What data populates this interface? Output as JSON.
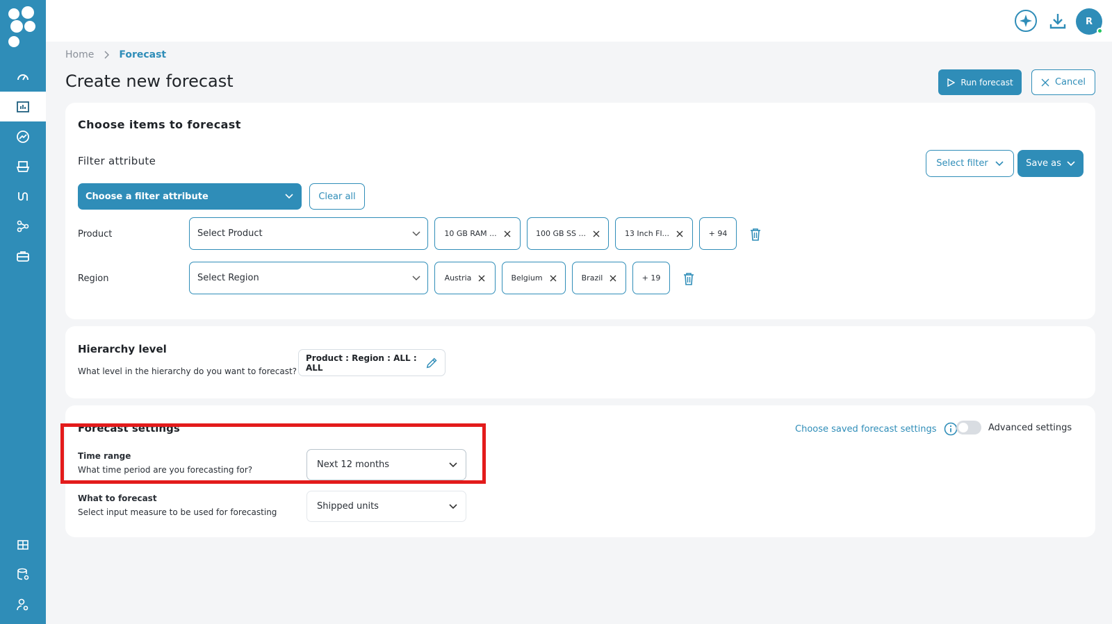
{
  "topbar": {
    "avatar_initial": "R"
  },
  "breadcrumb": {
    "home": "Home",
    "current": "Forecast"
  },
  "page": {
    "title": "Create new forecast",
    "run_label": "Run forecast",
    "cancel_label": "Cancel"
  },
  "items": {
    "title": "Choose items to forecast",
    "filter_attribute_label": "Filter attribute",
    "select_filter": "Select filter",
    "save_as": "Save as",
    "choose_attr": "Choose a filter attribute",
    "clear_all": "Clear all",
    "product": {
      "label": "Product",
      "placeholder": "Select Product",
      "chips": [
        "10 GB RAM ...",
        "100 GB SS ...",
        "13 Inch Fl..."
      ],
      "more": "+ 94"
    },
    "region": {
      "label": "Region",
      "placeholder": "Select Region",
      "chips": [
        "Austria",
        "Belgium",
        "Brazil"
      ],
      "more": "+ 19"
    }
  },
  "hierarchy": {
    "title": "Hierarchy level",
    "question": "What level in the hierarchy do you want to forecast?",
    "value": "Product : Region : ALL : ALL"
  },
  "settings": {
    "title": "Forecast settings",
    "saved_link": "Choose saved forecast settings",
    "advanced_label": "Advanced settings",
    "advanced_on": false,
    "time_range": {
      "label": "Time range",
      "desc": "What time period are you forecasting for?",
      "value": "Next 12 months"
    },
    "what": {
      "label": "What to forecast",
      "desc": "Select input measure to be used for forecasting",
      "value": "Shipped units"
    }
  },
  "colors": {
    "accent": "#2f8db8",
    "highlight": "#e31b1b"
  }
}
